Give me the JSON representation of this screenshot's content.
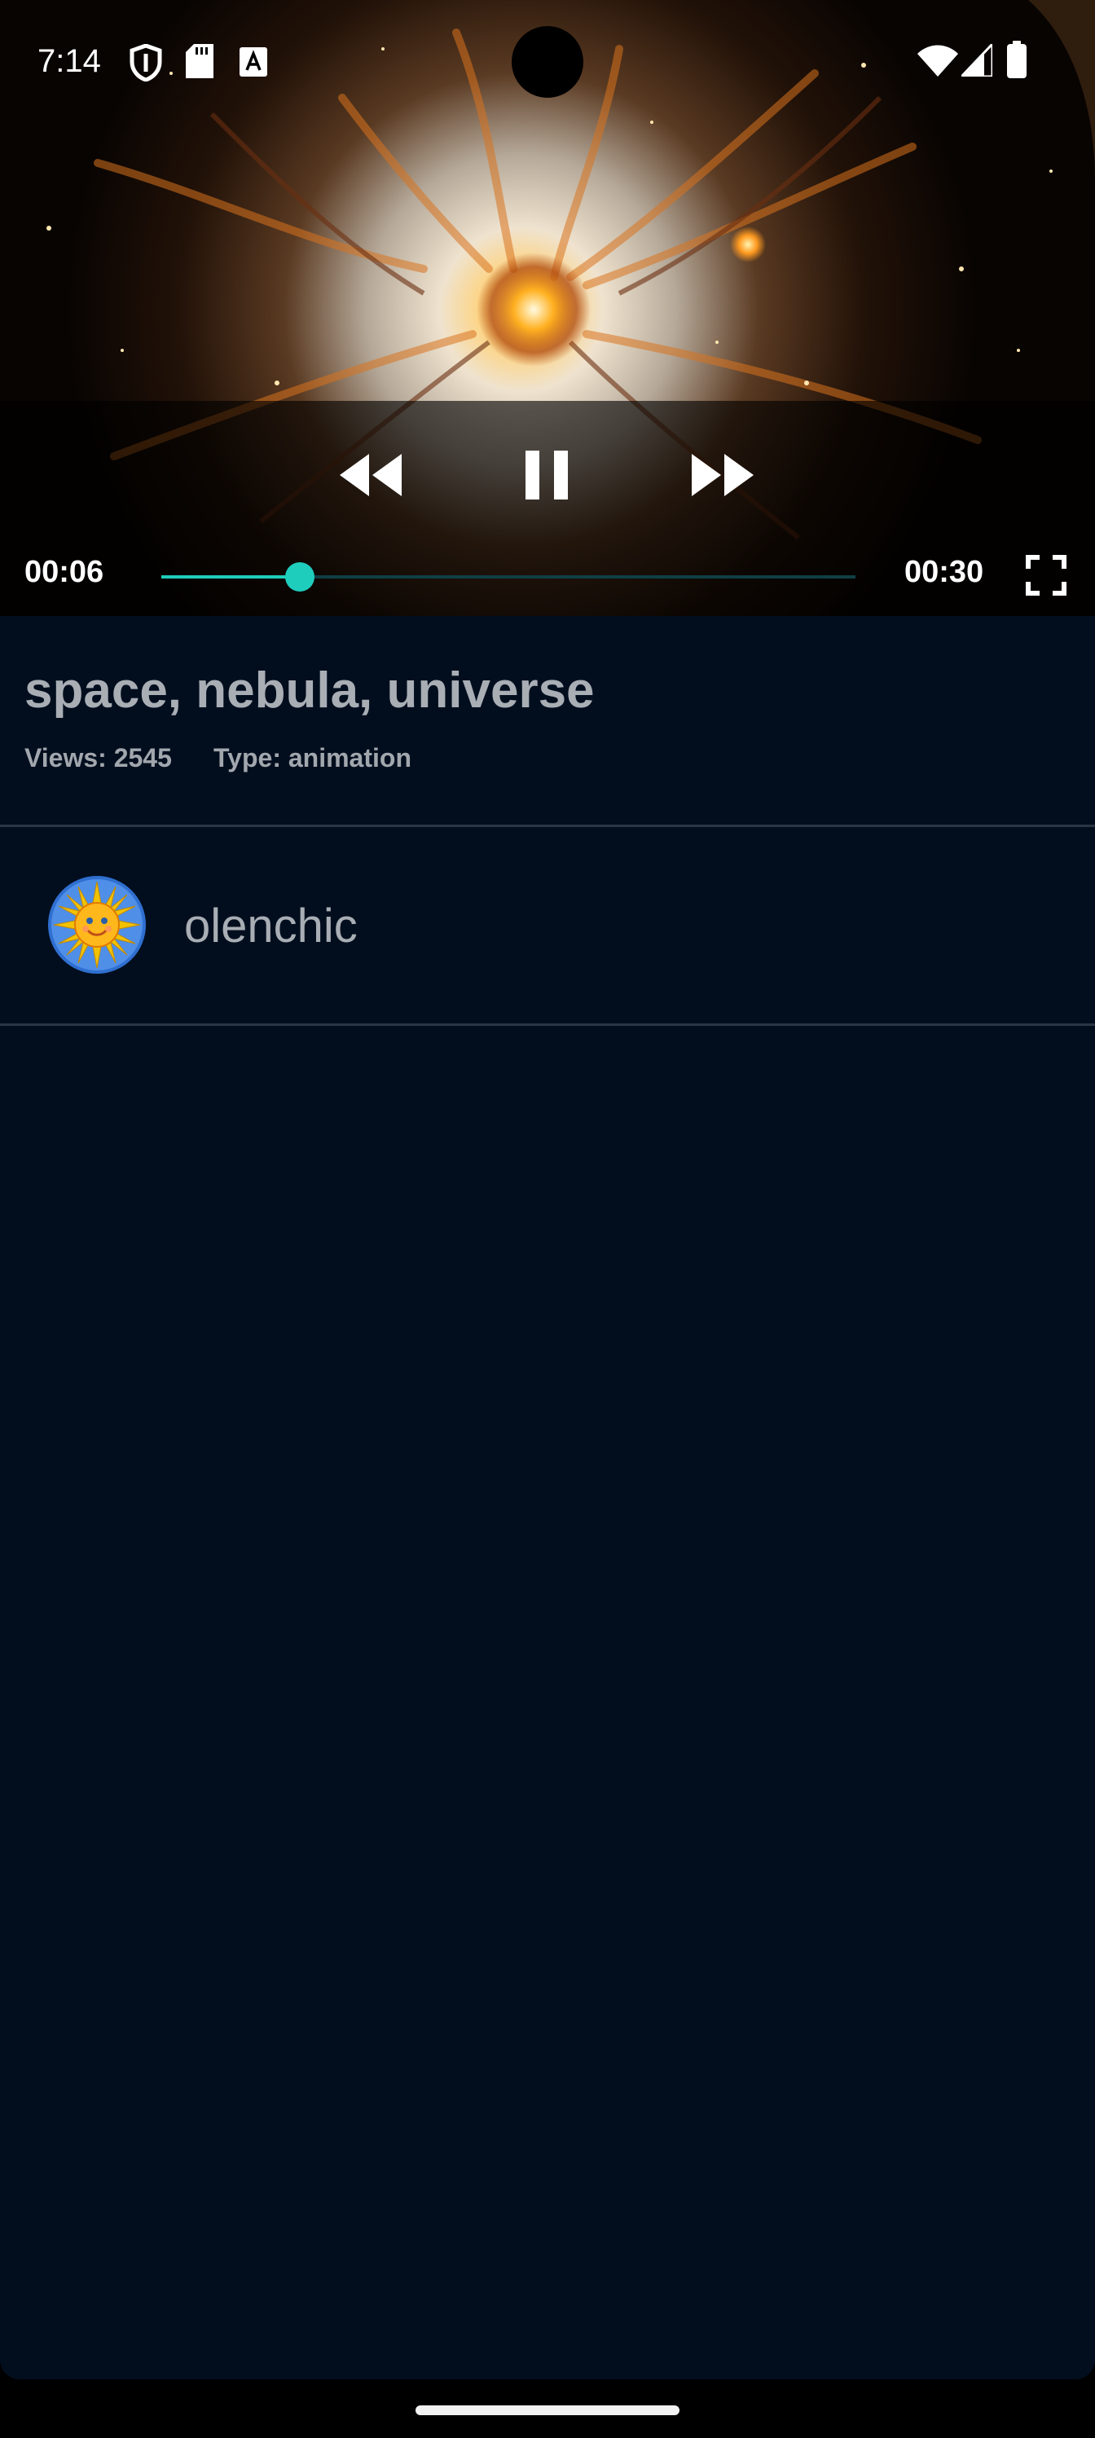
{
  "status_bar": {
    "time": "7:14",
    "left_icons": [
      "shield-icon",
      "sd-card-icon",
      "text-a-icon"
    ],
    "right_icons": [
      "wifi-icon",
      "cellular-icon",
      "battery-icon"
    ]
  },
  "player": {
    "current_time": "00:06",
    "duration": "00:30",
    "progress_fraction": 0.2,
    "accent_color": "#1fcdbd",
    "controls": [
      "rewind-icon",
      "pause-icon",
      "fast-forward-icon",
      "fullscreen-icon"
    ]
  },
  "video": {
    "title": "space, nebula, universe",
    "views_text": "Views: 2545",
    "type_text": "Type: animation"
  },
  "author": {
    "name": "olenchic",
    "avatar_icon": "sun-avatar-icon"
  },
  "colors": {
    "background": "#020e1e",
    "text": "#a9aeb5",
    "divider": "#2a3643"
  }
}
